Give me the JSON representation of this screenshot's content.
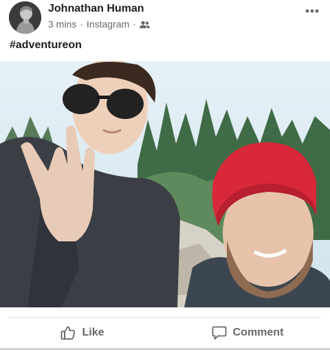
{
  "post": {
    "author": "Johnathan Human",
    "time": "3 mins",
    "separator": "·",
    "source": "Instagram",
    "caption": "#adventureon"
  },
  "icons": {
    "audience": "friends-icon",
    "more": "more-options-icon",
    "like": "thumbs-up-icon",
    "comment": "comment-bubble-icon"
  },
  "actions": {
    "like_label": "Like",
    "comment_label": "Comment"
  },
  "colors": {
    "text_primary": "#1c1e21",
    "text_secondary": "#65676b",
    "divider": "#dadde1",
    "beanie": "#d8283a"
  }
}
